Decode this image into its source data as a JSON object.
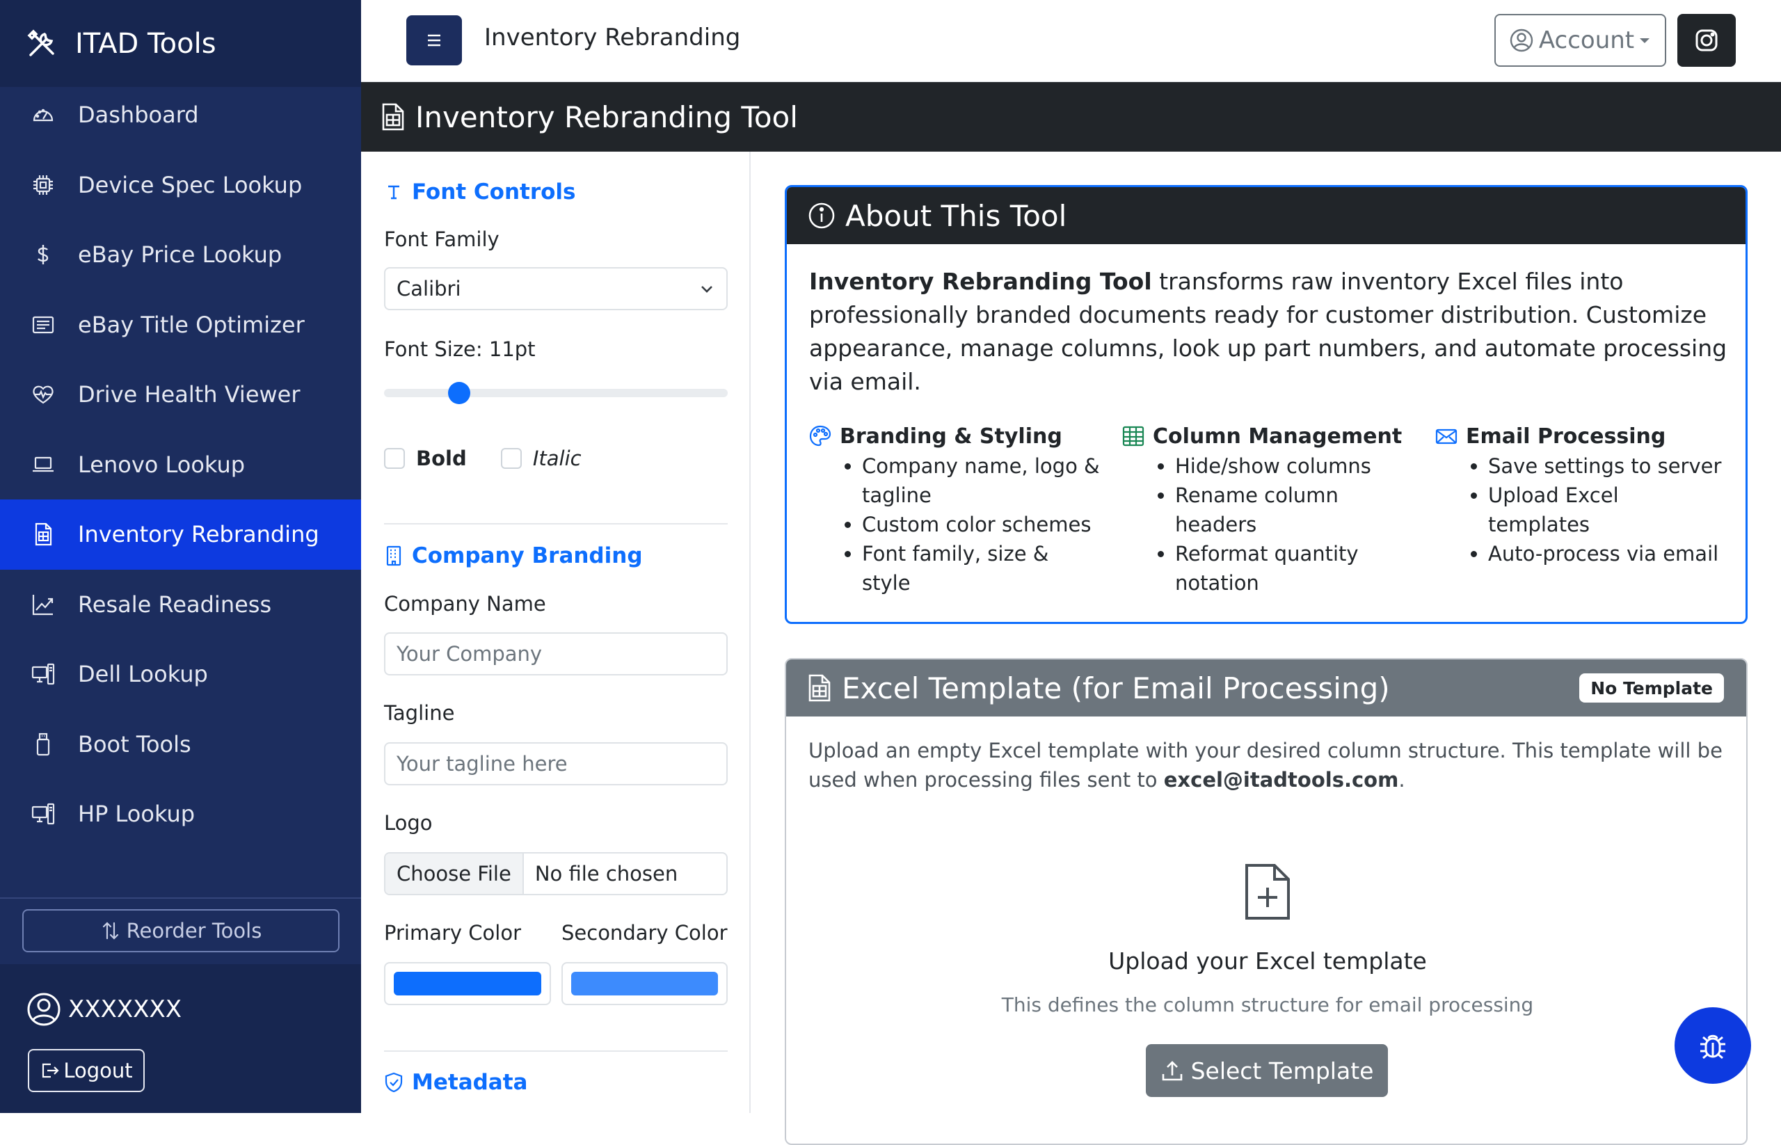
{
  "app": {
    "title": "ITAD Tools"
  },
  "sidebar": {
    "items": [
      {
        "label": "Dashboard",
        "icon": "speedometer-icon"
      },
      {
        "label": "Device Spec Lookup",
        "icon": "cpu-icon"
      },
      {
        "label": "eBay Price Lookup",
        "icon": "dollar-icon"
      },
      {
        "label": "eBay Title Optimizer",
        "icon": "card-text-icon"
      },
      {
        "label": "Drive Health Viewer",
        "icon": "heart-pulse-icon"
      },
      {
        "label": "Lenovo Lookup",
        "icon": "laptop-icon"
      },
      {
        "label": "Inventory Rebranding",
        "icon": "spreadsheet-icon",
        "active": true
      },
      {
        "label": "Resale Readiness",
        "icon": "graph-up-icon"
      },
      {
        "label": "Dell Lookup",
        "icon": "pc-display-icon"
      },
      {
        "label": "Boot Tools",
        "icon": "usb-drive-icon"
      },
      {
        "label": "HP Lookup",
        "icon": "pc-display-icon"
      }
    ],
    "reorder_label": "Reorder Tools",
    "user_name": "XXXXXXX",
    "logout_label": "Logout"
  },
  "topbar": {
    "page_title": "Inventory Rebranding",
    "account_label": "Account"
  },
  "titlebar": {
    "title": "Inventory Rebranding Tool"
  },
  "font_controls": {
    "title": "Font Controls",
    "family_label": "Font Family",
    "family_value": "Calibri",
    "size_label": "Font Size: 11pt",
    "size_fraction": 0.2,
    "bold_label": "Bold",
    "italic_label": "Italic"
  },
  "branding": {
    "title": "Company Branding",
    "name_label": "Company Name",
    "name_placeholder": "Your Company",
    "tagline_label": "Tagline",
    "tagline_placeholder": "Your tagline here",
    "logo_label": "Logo",
    "choose_file": "Choose File",
    "no_file": "No file chosen",
    "primary_label": "Primary Color",
    "secondary_label": "Secondary Color",
    "primary_color": "#0d6efd",
    "secondary_color": "#3d8bfd"
  },
  "metadata": {
    "title": "Metadata"
  },
  "about": {
    "title": "About This Tool",
    "lead_bold": "Inventory Rebranding Tool",
    "lead_rest": " transforms raw inventory Excel files into professionally branded documents ready for customer distribution. Customize appearance, manage columns, look up part numbers, and automate processing via email.",
    "features": [
      {
        "title": "Branding & Styling",
        "items": [
          "Company name, logo & tagline",
          "Custom color schemes",
          "Font family, size & style"
        ]
      },
      {
        "title": "Column Management",
        "items": [
          "Hide/show columns",
          "Rename column headers",
          "Reformat quantity notation"
        ]
      },
      {
        "title": "Email Processing",
        "items": [
          "Save settings to server",
          "Upload Excel templates",
          "Auto-process via email"
        ]
      }
    ]
  },
  "excel": {
    "title": "Excel Template (for Email Processing)",
    "badge": "No Template",
    "desc_pre": "Upload an empty Excel template with your desired column structure. This template will be used when processing files sent to ",
    "desc_email": "excel@itadtools.com",
    "desc_post": ".",
    "upload_title": "Upload your Excel template",
    "upload_sub": "This defines the column structure for email processing",
    "select_label": "Select Template"
  }
}
